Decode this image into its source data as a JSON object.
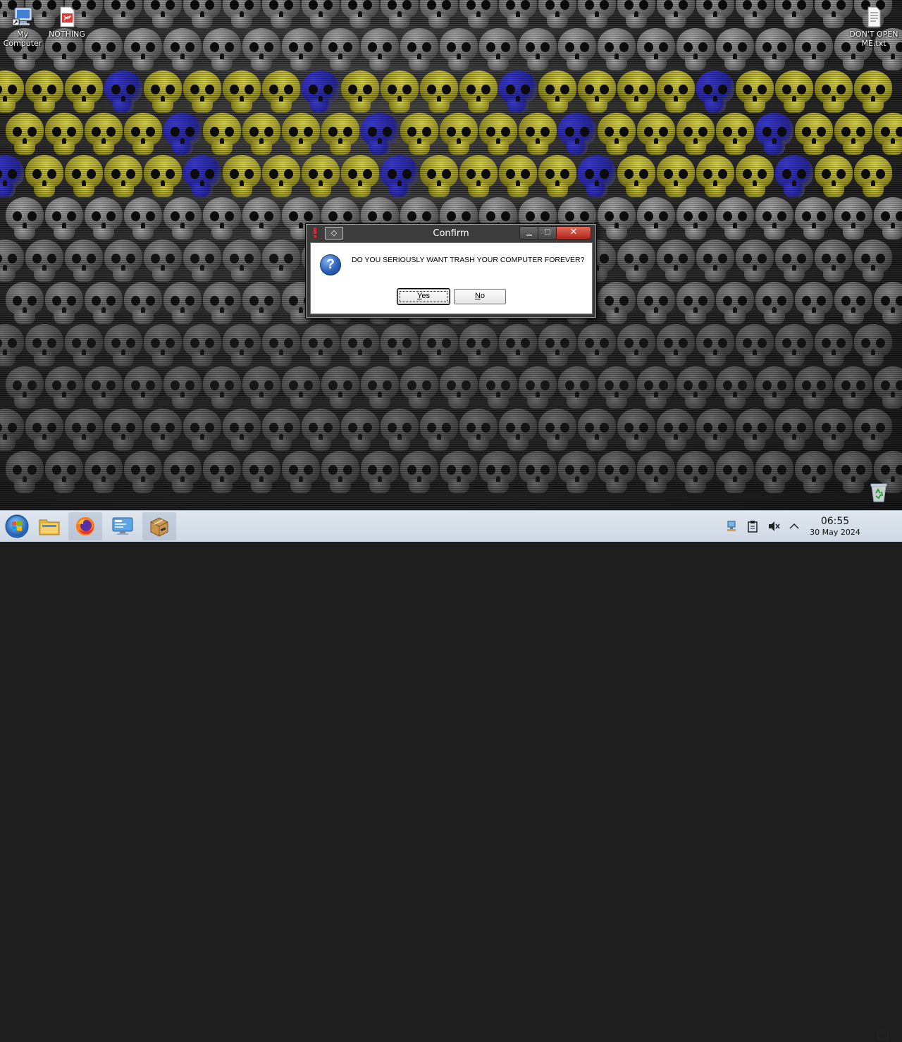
{
  "desktop": {
    "icons": [
      {
        "label": "My Computer",
        "icon": "my-computer-icon"
      },
      {
        "label": "NOTHING",
        "icon": "pdf-document-icon"
      },
      {
        "label": "DON'T OPEN ME.txt",
        "icon": "text-file-icon"
      }
    ],
    "recycle_bin_icon": "recycle-bin-icon"
  },
  "dialog": {
    "title": "Confirm",
    "message": "DO YOU SERIOUSLY WANT TRASH YOUR COMPUTER FOREVER?",
    "yes_label_first": "Y",
    "yes_label_rest": "es",
    "no_label_first": "N",
    "no_label_rest": "o",
    "close_glyph": "✕",
    "pin_glyph": "◇",
    "question_glyph": "?"
  },
  "taskbar": {
    "apps": [
      "start-menu-icon",
      "file-manager-icon",
      "firefox-icon",
      "system-monitor-icon",
      "package-installer-icon"
    ],
    "tray": [
      "network-icon",
      "clipboard-icon",
      "volume-muted-icon",
      "show-hidden-icons-chevron"
    ],
    "clock": {
      "time": "06:55",
      "date": "30 May 2024"
    }
  },
  "colors": {
    "close_button": "#c8382a",
    "taskbar_bg": "#d6dee8",
    "question_icon": "#2d63b8"
  }
}
